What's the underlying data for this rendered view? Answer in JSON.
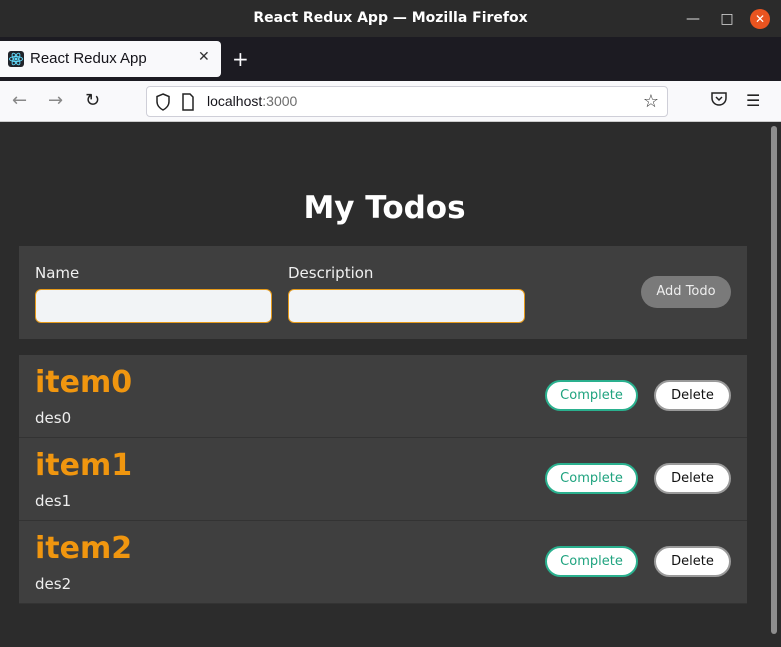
{
  "window": {
    "title": "React Redux App — Mozilla Firefox"
  },
  "tab": {
    "title": "React Redux App",
    "favicon": "react-logo-icon"
  },
  "urlbar": {
    "host": "localhost",
    "port": ":3000"
  },
  "page": {
    "title": "My Todos"
  },
  "form": {
    "name_label": "Name",
    "name_value": "",
    "description_label": "Description",
    "description_value": "",
    "add_label": "Add Todo"
  },
  "todos": [
    {
      "name": "item0",
      "description": "des0",
      "complete_label": "Complete",
      "delete_label": "Delete"
    },
    {
      "name": "item1",
      "description": "des1",
      "complete_label": "Complete",
      "delete_label": "Delete"
    },
    {
      "name": "item2",
      "description": "des2",
      "complete_label": "Complete",
      "delete_label": "Delete"
    }
  ],
  "colors": {
    "accent": "#f0960f",
    "complete": "#2ab08e",
    "panel": "#3f3f3f",
    "background": "#2c2c2c"
  }
}
